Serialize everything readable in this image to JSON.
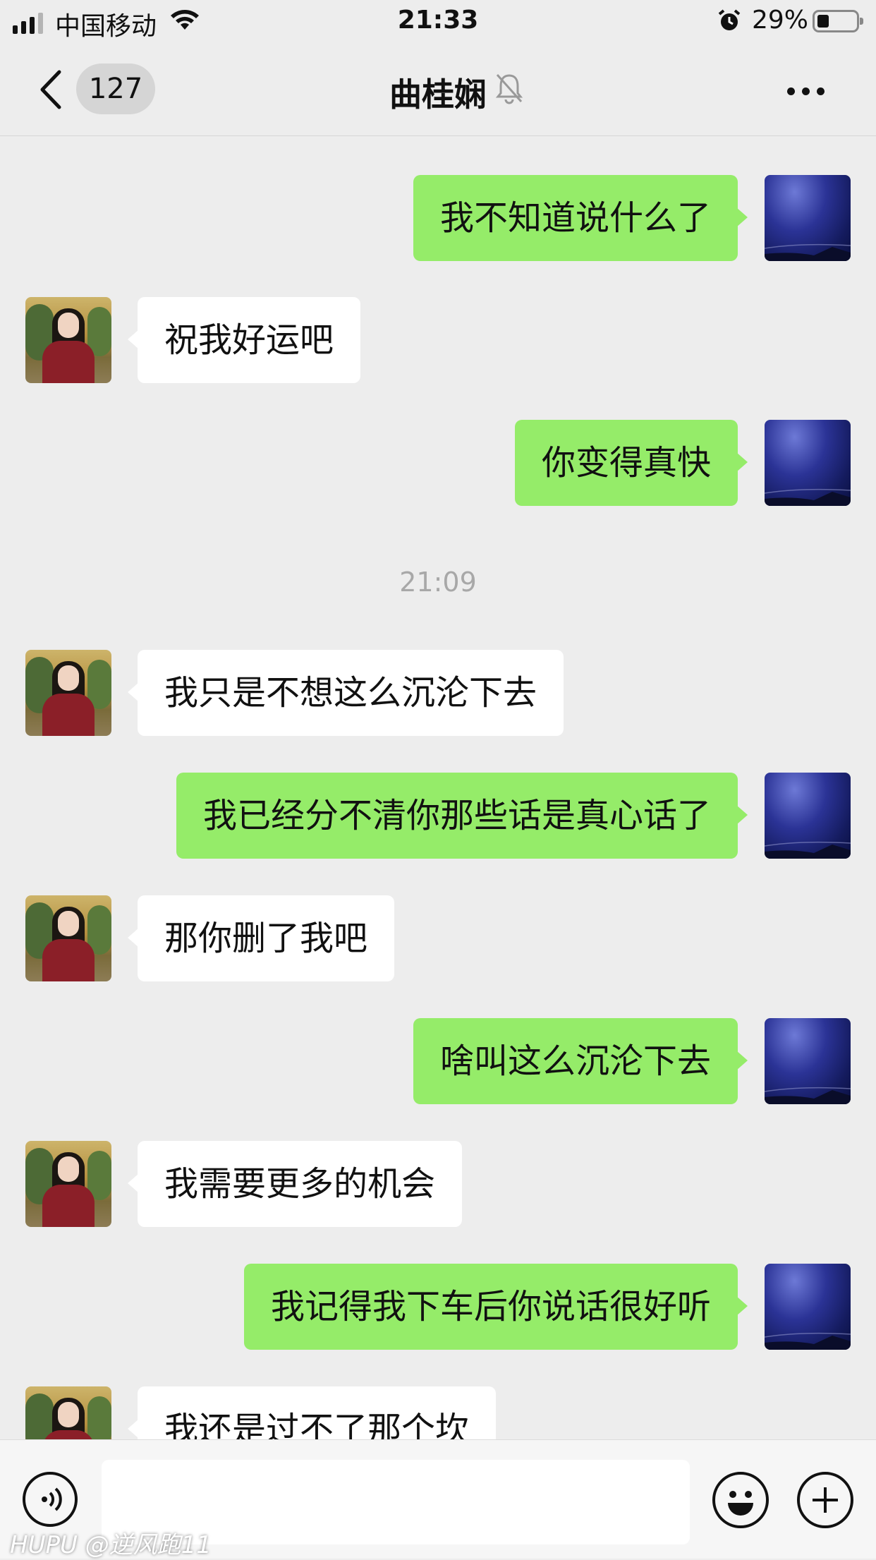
{
  "status_bar": {
    "carrier": "中国移动",
    "time": "21:33",
    "battery_percent": "29%",
    "battery_level": 0.29,
    "icons": [
      "signal-icon",
      "wifi-icon",
      "alarm-icon",
      "battery-icon"
    ]
  },
  "nav": {
    "back_icon": "chevron-left-icon",
    "unread_count": "127",
    "title": "曲桂娴",
    "mute_icon": "bell-muted-icon",
    "more_icon": "ellipsis-icon"
  },
  "messages": [
    {
      "from": "me",
      "text": "我不知道说什么了"
    },
    {
      "from": "her",
      "text": "祝我好运吧"
    },
    {
      "from": "me",
      "text": "你变得真快"
    },
    {
      "timestamp": "21:09"
    },
    {
      "from": "her",
      "text": "我只是不想这么沉沦下去"
    },
    {
      "from": "me",
      "text": "我已经分不清你那些话是真心话了"
    },
    {
      "from": "her",
      "text": "那你删了我吧"
    },
    {
      "from": "me",
      "text": "啥叫这么沉沦下去"
    },
    {
      "from": "her",
      "text": "我需要更多的机会"
    },
    {
      "from": "me",
      "text": "我记得我下车后你说话很好听"
    },
    {
      "from": "her",
      "text": "我还是过不了那个坎"
    }
  ],
  "input_bar": {
    "voice_icon": "voice-icon",
    "text_value": "",
    "emoji_icon": "emoji-icon",
    "plus_icon": "plus-icon"
  },
  "watermark": "HUPU @逆风跑11",
  "colors": {
    "background": "#ededed",
    "my_bubble": "#95ec69",
    "her_bubble": "#ffffff",
    "timestamp_text": "#a8a8a8"
  }
}
